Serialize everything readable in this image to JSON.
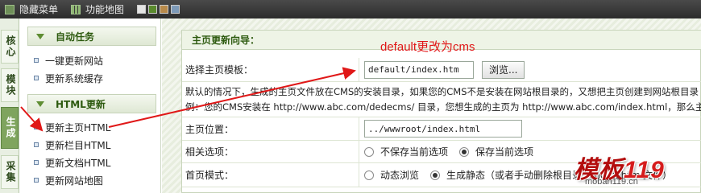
{
  "toolbar": {
    "hide_menu": "隐藏菜单",
    "site_map": "功能地图",
    "theme_colors": [
      "#e4e4e4",
      "#5a8a2e",
      "#b88a4a",
      "#7d9ab8"
    ]
  },
  "vtabs": [
    "核心",
    "模块",
    "生成",
    "采集"
  ],
  "menu": {
    "group1": {
      "title": "自动任务",
      "items": [
        "一键更新网站",
        "更新系统缓存"
      ]
    },
    "group2": {
      "title": "HTML更新",
      "items": [
        "更新主页HTML",
        "更新栏目HTML",
        "更新文档HTML",
        "更新网站地图"
      ]
    }
  },
  "panel": {
    "title": "主页更新向导：",
    "template_label": "选择主页模板：",
    "template_value": "default/index.htm",
    "browse_label": "浏览...",
    "note_line1": "默认的情况下，生成的主页文件放在CMS的安装目录，如果您的CMS不是安装在网站根目录的，又想把主页创建到网站根目录",
    "note_line2": "例：您的CMS安装在 http://www.abc.com/dedecms/ 目录，您想生成的主页为 http://www.abc.com/index.html，那么主页",
    "position_label": "主页位置：",
    "position_value": "../wwwroot/index.html",
    "options_label": "相关选项：",
    "options": [
      "不保存当前选项",
      "保存当前选项"
    ],
    "mode_label": "首页模式：",
    "modes": [
      "动态浏览",
      "生成静态（或者手动删除根目录下index.html文件）"
    ]
  },
  "annotation": "default更改为cms",
  "watermark": {
    "main": "模板",
    "num": "119",
    "sub": "moban119.cn"
  }
}
